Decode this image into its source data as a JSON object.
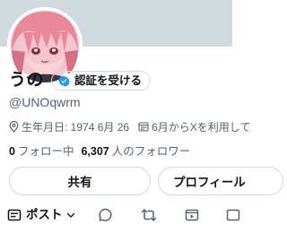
{
  "profile": {
    "display_name": "うの",
    "handle": "@UNOqwrm",
    "verify_button_label": "認証を受ける",
    "birthday": "生年月日: 1974 6月 26",
    "joined": "6月からXを利用して",
    "following_count": "0",
    "following_label": "フォロー中",
    "followers_count": "6,307",
    "followers_label": "人のフォロワー"
  },
  "actions": {
    "share_label": "共有",
    "profile_label": "プロフィール"
  },
  "tabs": {
    "post_label": "ポスト"
  },
  "colors": {
    "verify_blue": "#1d9bf0",
    "secondary_text": "#536471",
    "border": "#cfd9de",
    "avatar_hair": "#e8869a"
  }
}
